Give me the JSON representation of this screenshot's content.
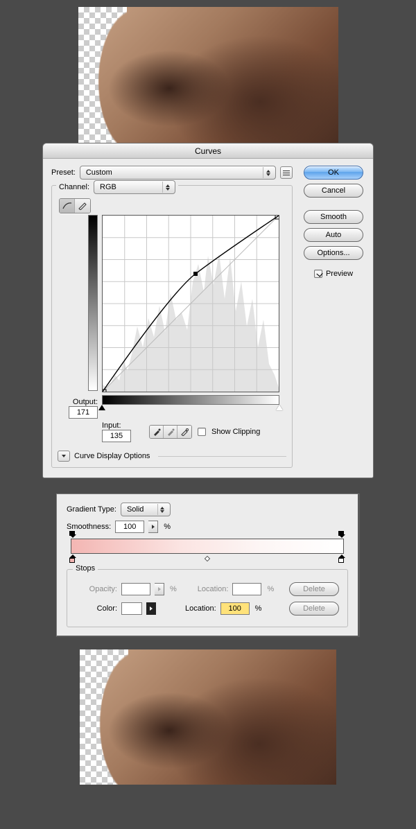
{
  "curves": {
    "title": "Curves",
    "preset_label": "Preset:",
    "preset_value": "Custom",
    "channel_label": "Channel:",
    "channel_value": "RGB",
    "output_label": "Output:",
    "output_value": "171",
    "input_label": "Input:",
    "input_value": "135",
    "show_clipping_label": "Show Clipping",
    "show_clipping_checked": false,
    "disclosure_label": "Curve Display Options",
    "buttons": {
      "ok": "OK",
      "cancel": "Cancel",
      "smooth": "Smooth",
      "auto": "Auto",
      "options": "Options..."
    },
    "preview_label": "Preview",
    "preview_checked": true
  },
  "gradient": {
    "type_label": "Gradient Type:",
    "type_value": "Solid",
    "smoothness_label": "Smoothness:",
    "smoothness_value": "100",
    "pct": "%",
    "stops_legend": "Stops",
    "opacity_label": "Opacity:",
    "opacity_value": "",
    "opacity_location_label": "Location:",
    "opacity_location_value": "",
    "color_label": "Color:",
    "color_location_label": "Location:",
    "color_location_value": "100",
    "delete_label": "Delete"
  },
  "chart_data": {
    "type": "line",
    "title": "Curves — RGB",
    "xlabel": "Input",
    "ylabel": "Output",
    "x": [
      0,
      135,
      255
    ],
    "y": [
      0,
      171,
      255
    ],
    "xlim": [
      0,
      255
    ],
    "ylim": [
      0,
      255
    ],
    "control_point": {
      "input": 135,
      "output": 171
    }
  }
}
